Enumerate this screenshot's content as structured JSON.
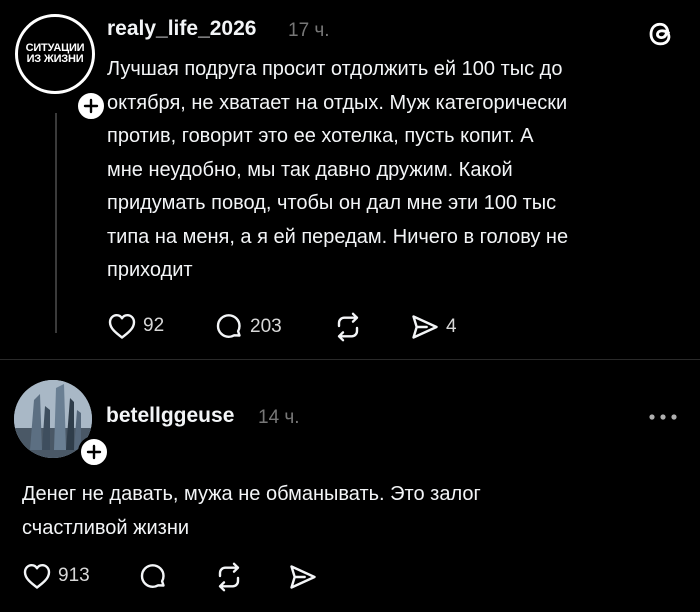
{
  "posts": [
    {
      "username": "realy_life_2026",
      "time": "17 ч.",
      "avatar_text_line1": "СИТУАЦИИ",
      "avatar_text_line2": "ИЗ ЖИЗНИ",
      "text_lines": [
        "Лучшая подруга просит отдолжить ей 100 тыс до",
        "октября, не хватает на отдых. Муж категорически",
        "против, говорит это ее хотелка, пусть копит. А",
        "мне неудобно, мы так давно дружим. Какой",
        "придумать повод, чтобы он дал мне эти 100 тыс",
        "типа на меня, а я ей передам. Ничего в голову не",
        "приходит"
      ],
      "likes": "92",
      "replies": "203",
      "reposts": "",
      "shares": "4"
    },
    {
      "username": "betellggeuse",
      "time": "14 ч.",
      "text_lines": [
        "Денег не давать, мужа не обманывать. Это залог",
        "счастливой жизни"
      ],
      "likes": "913",
      "replies": "",
      "reposts": "",
      "shares": ""
    }
  ],
  "icons": [
    "threads-logo-icon",
    "plus-icon",
    "heart-icon",
    "comment-icon",
    "repost-icon",
    "share-icon",
    "more-icon"
  ],
  "colors": {
    "background": "#000000",
    "text": "#f3f5f7",
    "muted": "#777777"
  }
}
